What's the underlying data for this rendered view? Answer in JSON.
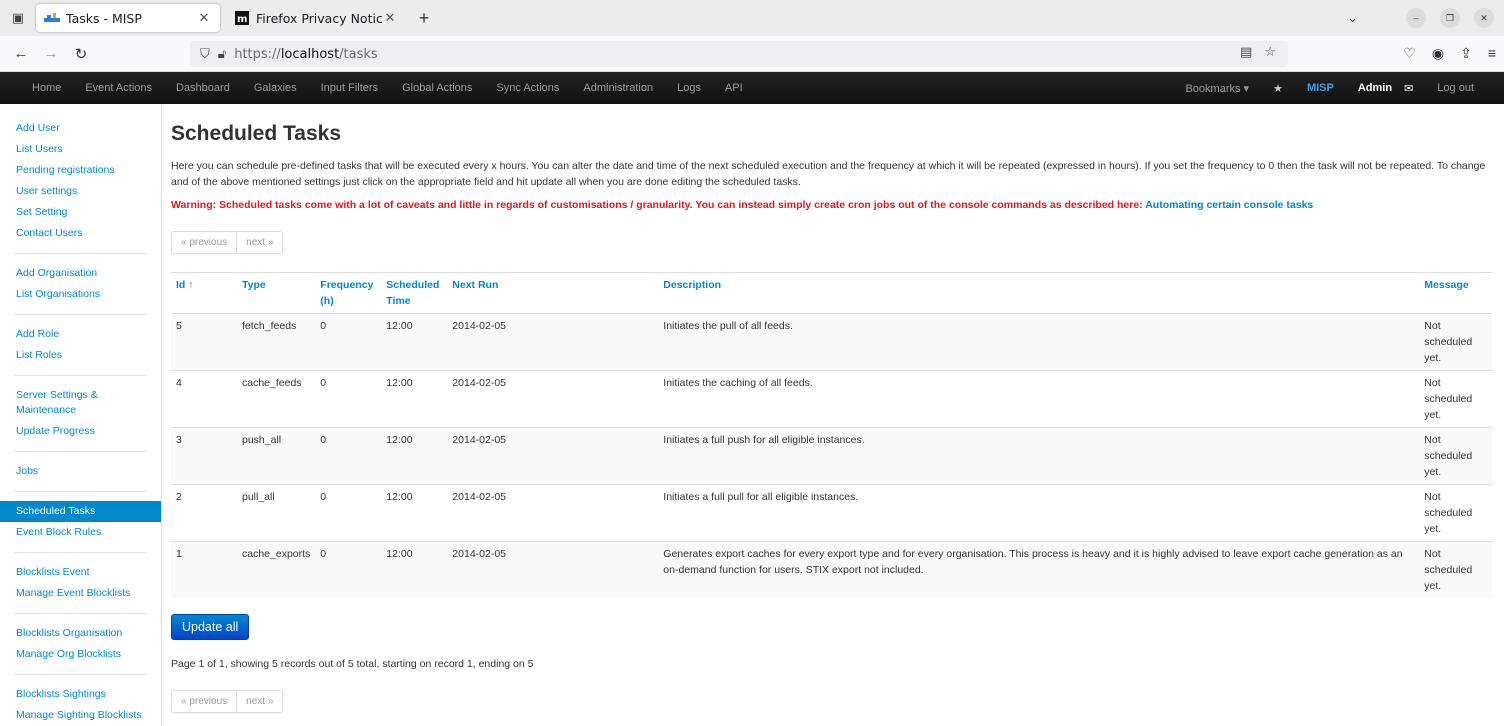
{
  "browser": {
    "tabs": [
      {
        "title": "Tasks - MISP",
        "active": true
      },
      {
        "title": "Firefox Privacy Notice —",
        "active": false
      }
    ],
    "url": {
      "proto": "https://",
      "host": "localhost",
      "path": "/tasks"
    }
  },
  "topmenu": {
    "left": [
      "Home",
      "Event Actions",
      "Dashboard",
      "Galaxies",
      "Input Filters",
      "Global Actions",
      "Sync Actions",
      "Administration",
      "Logs",
      "API"
    ],
    "bookmarks": "Bookmarks ▾",
    "brand": "MISP",
    "user": "Admin",
    "logout": "Log out"
  },
  "sidebar": {
    "groups": [
      [
        "Add User",
        "List Users",
        "Pending registrations",
        "User settings",
        "Set Setting",
        "Contact Users"
      ],
      [
        "Add Organisation",
        "List Organisations"
      ],
      [
        "Add Role",
        "List Roles"
      ],
      [
        "Server Settings & Maintenance",
        "Update Progress"
      ],
      [
        "Jobs"
      ],
      [
        "Scheduled Tasks",
        "Event Block Rules"
      ],
      [
        "Blocklists Event",
        "Manage Event Blocklists"
      ],
      [
        "Blocklists Organisation",
        "Manage Org Blocklists"
      ],
      [
        "Blocklists Sightings",
        "Manage Sighting Blocklists"
      ]
    ],
    "active": "Scheduled Tasks"
  },
  "page": {
    "title": "Scheduled Tasks",
    "intro": "Here you can schedule pre-defined tasks that will be executed every x hours. You can alter the date and time of the next scheduled execution and the frequency at which it will be repeated (expressed in hours). If you set the frequency to 0 then the task will not be repeated. To change and of the above mentioned settings just click on the appropriate field and hit update all when you are done editing the scheduled tasks.",
    "warning": "Warning: Scheduled tasks come with a lot of caveats and little in regards of customisations / granularity. You can instead simply create cron jobs out of the console commands as described here:",
    "warning_link": "Automating certain console tasks",
    "pager": {
      "previous": "« previous",
      "next": "next »"
    },
    "update_button": "Update all",
    "summary": "Page 1 of 1, showing 5 records out of 5 total, starting on record 1, ending on 5"
  },
  "table": {
    "headers": {
      "id": "Id ↑",
      "type": "Type",
      "frequency": "Frequency (h)",
      "scheduled": "Scheduled Time",
      "next_run": "Next Run",
      "description": "Description",
      "message": "Message"
    },
    "rows": [
      {
        "id": "5",
        "type": "fetch_feeds",
        "frequency": "0",
        "scheduled": "12:00",
        "next_run": "2014-02-05",
        "description": "Initiates the pull of all feeds.",
        "message": "Not scheduled yet."
      },
      {
        "id": "4",
        "type": "cache_feeds",
        "frequency": "0",
        "scheduled": "12:00",
        "next_run": "2014-02-05",
        "description": "Initiates the caching of all feeds.",
        "message": "Not scheduled yet."
      },
      {
        "id": "3",
        "type": "push_all",
        "frequency": "0",
        "scheduled": "12:00",
        "next_run": "2014-02-05",
        "description": "Initiates a full push for all eligible instances.",
        "message": "Not scheduled yet."
      },
      {
        "id": "2",
        "type": "pull_all",
        "frequency": "0",
        "scheduled": "12:00",
        "next_run": "2014-02-05",
        "description": "Initiates a full pull for all eligible instances.",
        "message": "Not scheduled yet."
      },
      {
        "id": "1",
        "type": "cache_exports",
        "frequency": "0",
        "scheduled": "12:00",
        "next_run": "2014-02-05",
        "description": "Generates export caches for every export type and for every organisation. This process is heavy and it is highly advised to leave export cache generation as an on-demand function for users. STIX export not included.",
        "message": "Not scheduled yet."
      }
    ]
  }
}
